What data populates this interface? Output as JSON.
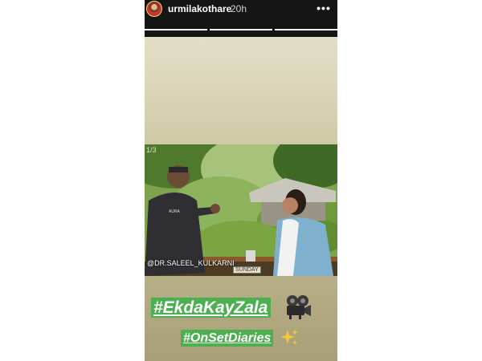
{
  "header": {
    "username": "urmilakothare",
    "time": "20h",
    "more_icon": "more-options-icon",
    "progress": [
      1.0,
      1.0,
      1.0
    ]
  },
  "photo": {
    "index": "1/3",
    "credit": "@DR.SALEEL_KULKARNI",
    "mug_text": "SUNDAY"
  },
  "captions": {
    "tag1": "#EkdaKayZala",
    "tag2": "#OnSetDiaries",
    "tag1_icon": "movie-camera-icon",
    "tag2_icon": "sparkles-icon"
  },
  "colors": {
    "header_bg": "#151515",
    "tag_bg": "#4caf50",
    "tag_text": "#ffffff",
    "sparkle": "#f4c542"
  }
}
